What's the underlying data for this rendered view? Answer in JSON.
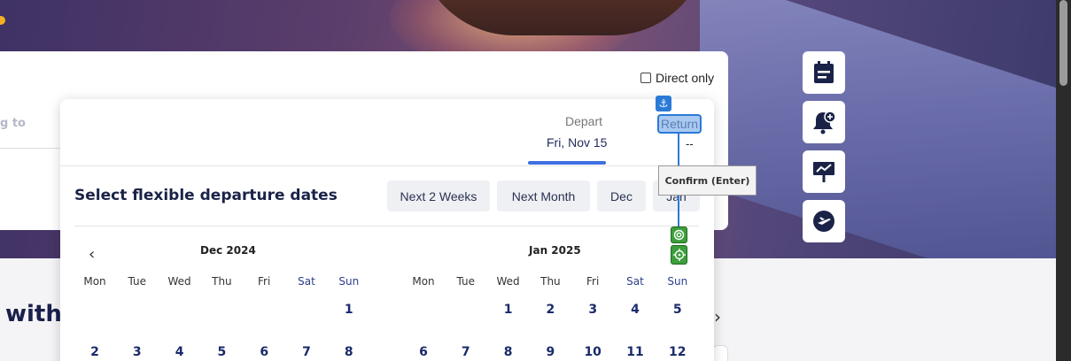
{
  "search": {
    "direct_only_label": "Direct only",
    "going_to_partial": "g to"
  },
  "date_tabs": {
    "depart_label": "Depart",
    "depart_value": "Fri, Nov 15",
    "return_label": "Return",
    "return_value": "--"
  },
  "flex": {
    "title": "Select flexible departure dates",
    "chips": [
      "Next 2 Weeks",
      "Next Month",
      "Dec",
      "Jan"
    ]
  },
  "calendar": {
    "weekdays": [
      "Mon",
      "Tue",
      "Wed",
      "Thu",
      "Fri",
      "Sat",
      "Sun"
    ],
    "months": [
      {
        "title": "Dec 2024",
        "rows": [
          [
            "",
            "",
            "",
            "",
            "",
            "",
            "1"
          ],
          [
            "2",
            "3",
            "4",
            "5",
            "6",
            "7",
            "8"
          ]
        ]
      },
      {
        "title": "Jan 2025",
        "rows": [
          [
            "",
            "",
            "1",
            "2",
            "3",
            "4",
            "5"
          ],
          [
            "6",
            "7",
            "8",
            "9",
            "10",
            "11",
            "12"
          ]
        ]
      }
    ]
  },
  "tooltip": {
    "text": "Confirm (Enter)"
  },
  "lower": {
    "heading_partial": "with"
  },
  "side_buttons": [
    {
      "icon": "calendar-icon"
    },
    {
      "icon": "bell-add-icon"
    },
    {
      "icon": "billboard-icon"
    },
    {
      "icon": "plane-icon"
    }
  ],
  "colors": {
    "accent_blue": "#3f6fe0",
    "navy_text": "#1a2a6a",
    "highlight_blue": "#2a7ad6",
    "target_green": "#3c9e3c"
  }
}
